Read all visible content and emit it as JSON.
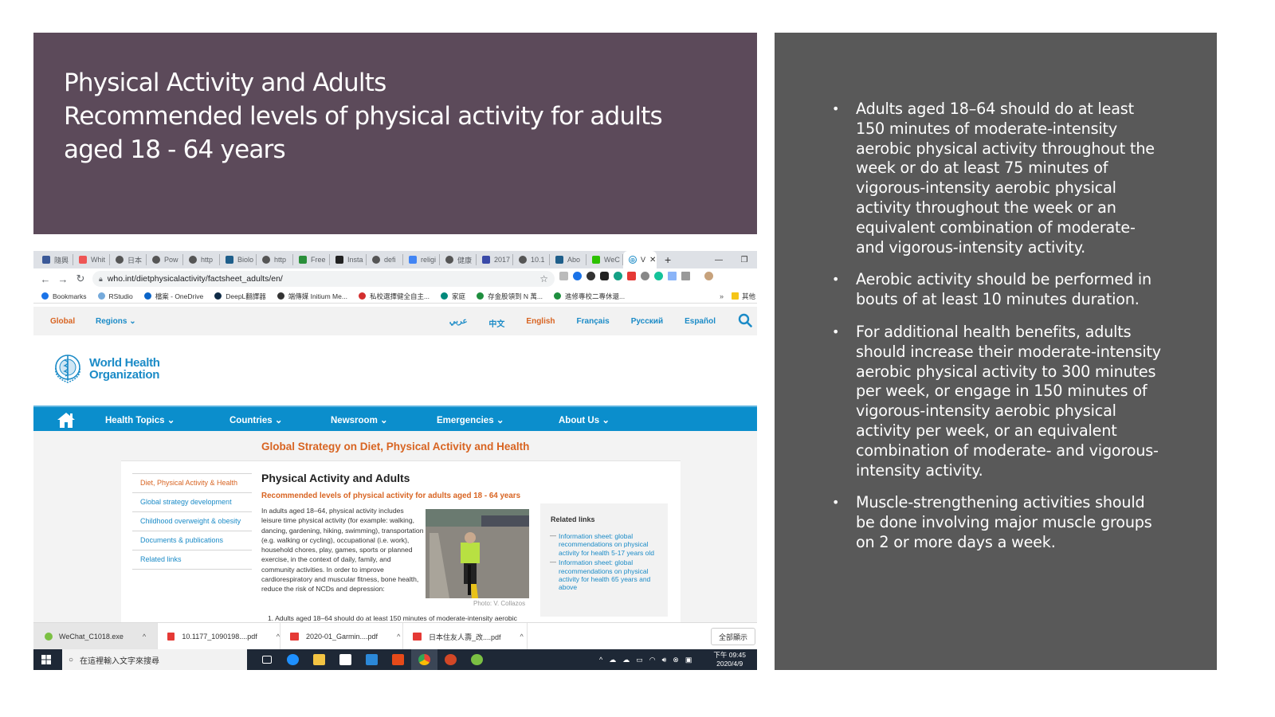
{
  "slide": {
    "title_lines": [
      "Physical Activity and Adults",
      "Recommended levels of physical activity for adults",
      "aged 18 - 64 years"
    ],
    "bullets": [
      "Adults aged 18–64 should do at least 150 minutes of moderate-intensity aerobic physical activity throughout the week or do at least 75 minutes of vigorous-intensity aerobic physical activity throughout the week or an equivalent combination of moderate- and vigorous-intensity activity.",
      "Aerobic activity should be performed in bouts of at least 10 minutes duration.",
      "For additional health benefits, adults should increase their moderate-intensity aerobic physical activity to 300 minutes per week, or engage in 150 minutes of vigorous-intensity aerobic physical activity per week, or an equivalent combination of moderate- and vigorous-intensity activity.",
      "Muscle-strengthening activities should be done involving major muscle groups on 2 or more days a week."
    ],
    "colors": {
      "title_bg": "#5c4a5a",
      "bullet_bg": "#595959"
    }
  },
  "browser": {
    "tabs": [
      {
        "label": "隨興",
        "icon": "facebook-icon",
        "color": "#3b5998"
      },
      {
        "label": "Whit",
        "icon": "whitepaper-icon",
        "color": "#e55"
      },
      {
        "label": "日本",
        "icon": "globe-icon",
        "color": "#555"
      },
      {
        "label": "Pow",
        "icon": "globe-icon",
        "color": "#555"
      },
      {
        "label": "http",
        "icon": "globe-icon",
        "color": "#555"
      },
      {
        "label": "Biolo",
        "icon": "journal-icon",
        "color": "#1f5f8b"
      },
      {
        "label": "http",
        "icon": "globe-icon",
        "color": "#555"
      },
      {
        "label": "Free",
        "icon": "bolt-icon",
        "color": "#2a8f3a"
      },
      {
        "label": "Insta",
        "icon": "instapaper-icon",
        "color": "#222"
      },
      {
        "label": "defi",
        "icon": "globe-icon",
        "color": "#555"
      },
      {
        "label": "religi",
        "icon": "google-icon",
        "color": "#4285f4"
      },
      {
        "label": "健康",
        "icon": "globe-icon",
        "color": "#555"
      },
      {
        "label": "2017",
        "icon": "dcu-icon",
        "color": "#3a4aa8"
      },
      {
        "label": "10.1",
        "icon": "globe-icon",
        "color": "#555"
      },
      {
        "label": "Abo",
        "icon": "journal-icon",
        "color": "#1f5f8b"
      },
      {
        "label": "WeC",
        "icon": "wechat-icon",
        "color": "#2dc100"
      }
    ],
    "active_tab": {
      "label": "V",
      "icon": "who-icon"
    },
    "url": "who.int/dietphysicalactivity/factsheet_adults/en/",
    "bookmarks": [
      {
        "label": "Bookmarks",
        "color": "#1a73e8"
      },
      {
        "label": "RStudio",
        "color": "#75aadb"
      },
      {
        "label": "檔案 - OneDrive",
        "color": "#0a64c8"
      },
      {
        "label": "DeepL翻譯器",
        "color": "#0f2b46"
      },
      {
        "label": "端傳媒 Initium Me...",
        "color": "#333"
      },
      {
        "label": "私校選擇健全自主...",
        "color": "#d32f2f"
      },
      {
        "label": "家庭",
        "color": "#00897b"
      },
      {
        "label": "存金股領到 N 萬...",
        "color": "#1e8e3e"
      },
      {
        "label": "進修專校二專休還...",
        "color": "#1e8e3e"
      }
    ],
    "bookmarks_more": "»",
    "other_bookmarks": "其他",
    "downloads": [
      {
        "name": "WeChat_C1018.exe",
        "type": "exe"
      },
      {
        "name": "10.1177_1090198....pdf",
        "type": "pdf"
      },
      {
        "name": "2020-01_Garmin....pdf",
        "type": "pdf"
      },
      {
        "name": "日本住友人壽_改....pdf",
        "type": "pdf"
      }
    ],
    "show_all": "全部顯示"
  },
  "who": {
    "global": "Global",
    "regions": "Regions",
    "languages": [
      "عربي",
      "中文",
      "English",
      "Français",
      "Русский",
      "Español"
    ],
    "current_language": "English",
    "logo_line1": "World Health",
    "logo_line2": "Organization",
    "nav": [
      "Health Topics",
      "Countries",
      "Newsroom",
      "Emergencies",
      "About Us"
    ],
    "section_title": "Global Strategy on Diet, Physical Activity and Health",
    "sidenav": [
      "Diet, Physical Activity & Health",
      "Global strategy development",
      "Childhood overweight & obesity",
      "Documents & publications",
      "Related links"
    ],
    "article_title": "Physical Activity and Adults",
    "article_subtitle": "Recommended levels of physical activity for adults aged 18 - 64 years",
    "article_text": "In adults aged 18–64, physical activity includes leisure time physical activity (for example: walking, dancing, gardening, hiking, swimming), transportation (e.g. walking or cycling), occupational (i.e. work), household chores, play, games, sports or planned exercise, in the context of daily, family, and community activities. In order to improve cardiorespiratory and muscular fitness, bone health, reduce the risk of NCDs and depression:",
    "photo_caption": "Photo: V. Collazos",
    "related_title": "Related links",
    "related_links": [
      "Information sheet: global recommendations on physical activity for health 5-17 years old",
      "Information sheet: global recommendations on physical activity for health 65 years and above"
    ],
    "list_start": "1. Adults aged 18–64 should do at least 150 minutes of moderate-intensity aerobic",
    "colors": {
      "accent_orange": "#d86422",
      "link_blue": "#1b8bc7",
      "nav_blue": "#0b8ecc"
    }
  },
  "taskbar": {
    "search_placeholder": "在這裡輸入文字來搜尋",
    "time": "下午 09:45",
    "date": "2020/4/9"
  }
}
